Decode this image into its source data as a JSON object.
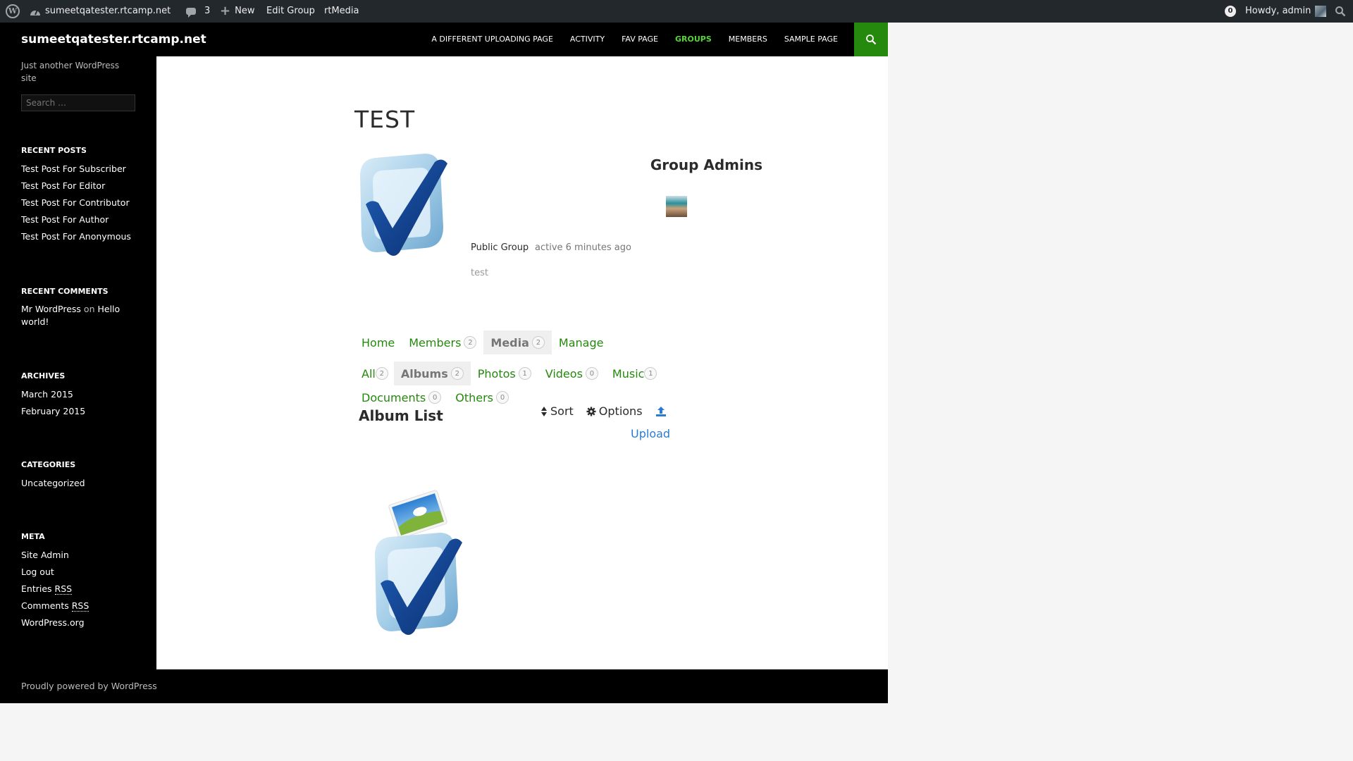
{
  "adminbar": {
    "site_name": "sumeetqatester.rtcamp.net",
    "comments_count": "3",
    "new_label": "New",
    "edit_group": "Edit Group",
    "rtmedia": "rtMedia",
    "notifications": "0",
    "howdy": "Howdy, admin"
  },
  "site": {
    "title": "sumeetqatester.rtcamp.net",
    "description": "Just another WordPress site",
    "nav": [
      "A DIFFERENT UPLOADING PAGE",
      "ACTIVITY",
      "FAV PAGE",
      "GROUPS",
      "MEMBERS",
      "SAMPLE PAGE"
    ],
    "nav_current": "GROUPS"
  },
  "sidebar": {
    "search_placeholder": "Search …",
    "recent_posts_title": "RECENT POSTS",
    "recent_posts": [
      "Test Post For Subscriber",
      "Test Post For Editor",
      "Test Post For Contributor",
      "Test Post For Author",
      "Test Post For Anonymous"
    ],
    "recent_comments_title": "RECENT COMMENTS",
    "recent_comment_author": "Mr WordPress",
    "recent_comment_on": "on",
    "recent_comment_post": "Hello world!",
    "archives_title": "ARCHIVES",
    "archives": [
      "March 2015",
      "February 2015"
    ],
    "categories_title": "CATEGORIES",
    "categories": [
      "Uncategorized"
    ],
    "meta_title": "META",
    "meta_site_admin": "Site Admin",
    "meta_log_out": "Log out",
    "meta_entries": "Entries",
    "meta_comments": "Comments",
    "meta_rss": "RSS",
    "meta_wordpress": "WordPress.org"
  },
  "group": {
    "name": "TEST",
    "admins_title": "Group Admins",
    "type": "Public Group",
    "activity": "active 6 minutes ago",
    "description": "test"
  },
  "group_nav": [
    {
      "label": "Home",
      "count": null,
      "active": false
    },
    {
      "label": "Members",
      "count": "2",
      "active": false
    },
    {
      "label": "Media",
      "count": "2",
      "active": true
    },
    {
      "label": "Manage",
      "count": null,
      "active": false
    }
  ],
  "media_nav": {
    "row1": [
      {
        "label": "All",
        "count": "2",
        "active": false
      },
      {
        "label": "Albums",
        "count": "2",
        "active": true
      },
      {
        "label": "Photos",
        "count": "1",
        "active": false
      },
      {
        "label": "Videos",
        "count": "0",
        "active": false
      },
      {
        "label": "Music",
        "count": "1",
        "active": false
      }
    ],
    "row2": [
      {
        "label": "Documents",
        "count": "0",
        "active": false
      },
      {
        "label": "Others",
        "count": "0",
        "active": false
      }
    ]
  },
  "album": {
    "list_title": "Album List",
    "sort_label": "Sort",
    "options_label": "Options",
    "upload_label": "Upload"
  },
  "footer": {
    "text": "Proudly powered by WordPress"
  },
  "colors": {
    "accent_green": "#24890d",
    "nav_current": "#55d737",
    "upload_blue": "#2a7cd0",
    "adminbar_bg": "#23282d"
  }
}
